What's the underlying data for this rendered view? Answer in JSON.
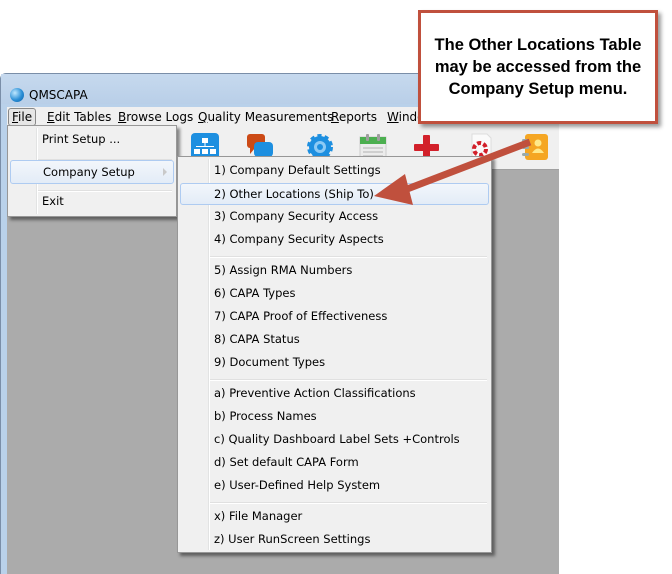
{
  "window": {
    "title": "QMSCAPA"
  },
  "menubar": {
    "items": [
      {
        "label": "File",
        "accel": "F",
        "rest": "ile"
      },
      {
        "label": "Edit Tables",
        "accel": "E",
        "rest": "dit Tables"
      },
      {
        "label": "Browse Logs",
        "accel": "B",
        "rest": "rowse Logs"
      },
      {
        "label": "Quality Measurements",
        "accel": "Q",
        "rest": "uality Measurements"
      },
      {
        "label": "Reports",
        "accel": "R",
        "rest": "eports"
      },
      {
        "label": "Window",
        "accel": "W",
        "rest": "indo"
      }
    ]
  },
  "toolbar": {
    "icons": [
      "org-chart-icon",
      "chat-bubbles-icon",
      "gear-icon",
      "calendar-icon",
      "red-cross-icon",
      "lifebuoy-icon",
      "contacts-book-icon"
    ]
  },
  "file_menu": {
    "items": [
      {
        "label": "Print Setup ..."
      },
      {
        "label": "Company Setup",
        "has_submenu": true
      },
      {
        "label": "Exit"
      }
    ]
  },
  "company_setup_menu": {
    "groups": [
      [
        "1) Company Default Settings",
        "2) Other Locations (Ship To)",
        "3) Company Security Access",
        "4) Company Security Aspects"
      ],
      [
        "5) Assign RMA Numbers",
        "6) CAPA Types",
        "7) CAPA Proof of Effectiveness",
        "8) CAPA Status",
        "9) Document Types"
      ],
      [
        "a) Preventive Action Classifications",
        "b) Process Names",
        "c) Quality Dashboard Label Sets +Controls",
        "d) Set default CAPA Form",
        "e) User-Defined Help System"
      ],
      [
        "x) File Manager",
        "z) User RunScreen Settings"
      ]
    ],
    "highlighted": "2) Other Locations (Ship To)"
  },
  "callout": {
    "text": "The Other Locations Table may be accessed from the Company Setup menu.",
    "border_color": "#c0503d"
  }
}
